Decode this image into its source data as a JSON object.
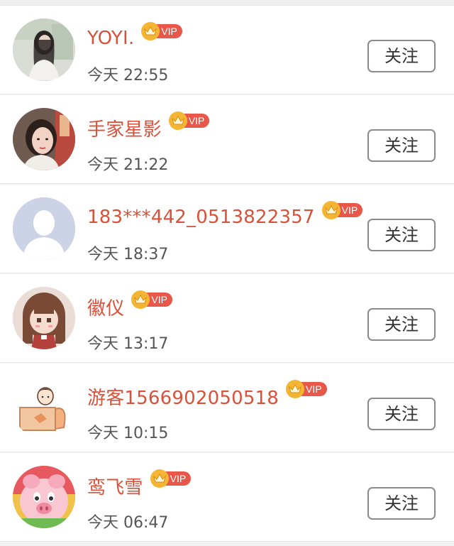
{
  "users": [
    {
      "name": "YOYI.",
      "time": "今天 22:55",
      "vip": "VIP",
      "follow": "关注",
      "avatar": "girl-photo-avatar"
    },
    {
      "name": "手家星影",
      "time": "今天 21:22",
      "vip": "VIP",
      "follow": "关注",
      "avatar": "selfie-avatar"
    },
    {
      "name": "183***442_0513822357",
      "time": "今天 18:37",
      "vip": "VIP",
      "follow": "关注",
      "avatar": "default-user-avatar"
    },
    {
      "name": "徽仪",
      "time": "今天 13:17",
      "vip": "VIP",
      "follow": "关注",
      "avatar": "pixel-anime-girl-avatar"
    },
    {
      "name": "游客1566902050518",
      "time": "今天 10:15",
      "vip": "VIP",
      "follow": "关注",
      "avatar": "cartoon-boy-avatar"
    },
    {
      "name": "鸾飞雪",
      "time": "今天 06:47",
      "vip": "VIP",
      "follow": "关注",
      "avatar": "cartoon-pig-avatar"
    }
  ],
  "colors": {
    "name": "#d9513b",
    "vip_badge": "#e8574a",
    "crown": "#f4b534",
    "time": "#555555",
    "button_border": "#8a8a8a"
  }
}
